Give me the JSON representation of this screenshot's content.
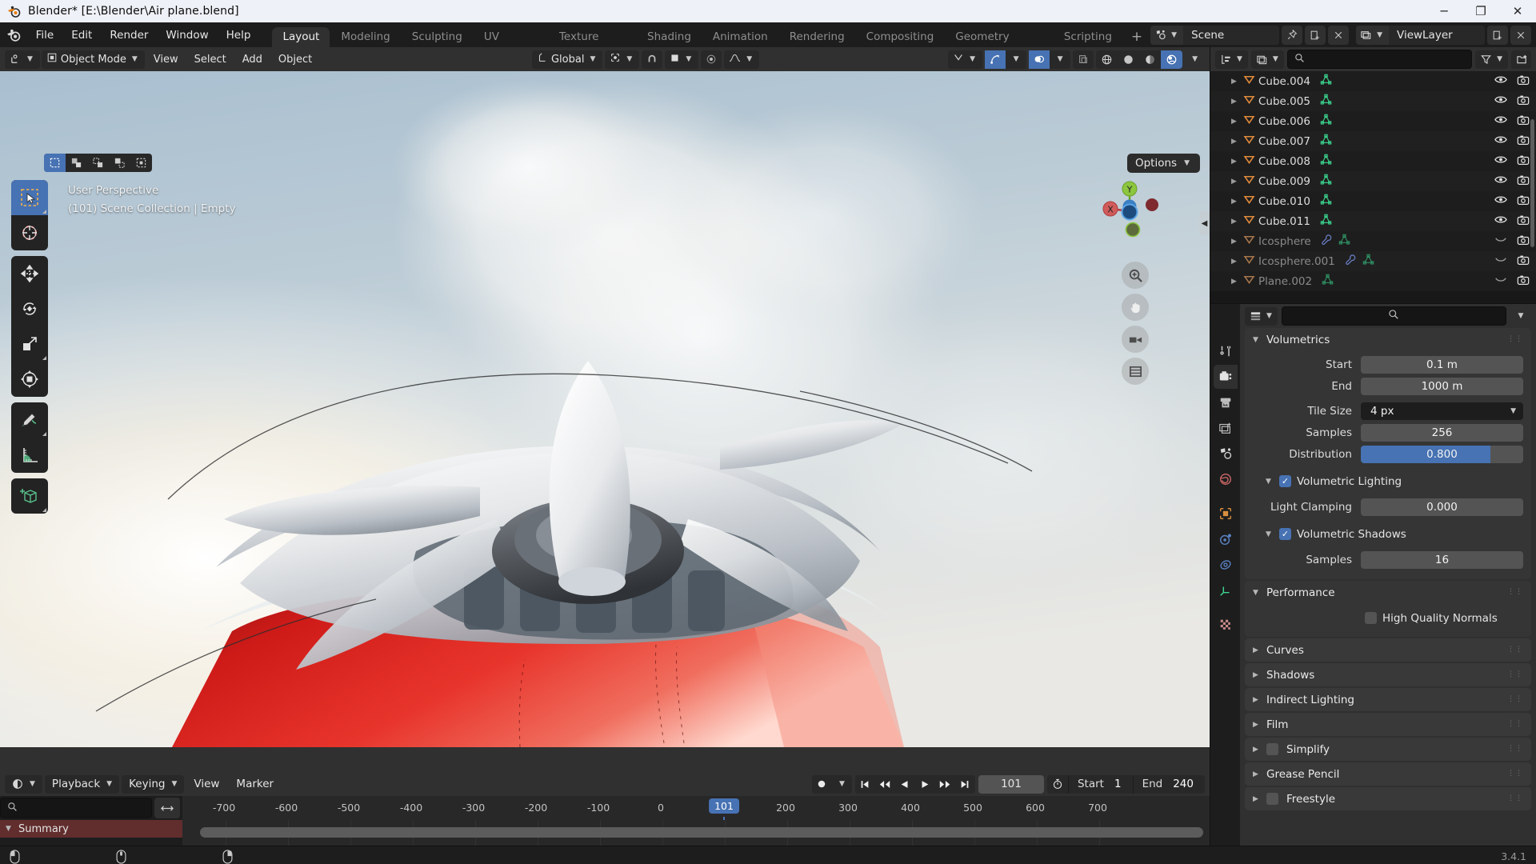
{
  "window": {
    "title": "Blender* [E:\\Blender\\Air plane.blend]",
    "minimize": "─",
    "maximize": "❐",
    "close": "✕"
  },
  "topbar": {
    "menus": [
      "File",
      "Edit",
      "Render",
      "Window",
      "Help"
    ],
    "workspaces": [
      "Layout",
      "Modeling",
      "Sculpting",
      "UV Editing",
      "Texture Paint",
      "Shading",
      "Animation",
      "Rendering",
      "Compositing",
      "Geometry Nodes",
      "Scripting"
    ],
    "active_workspace": "Layout",
    "add_workspace": "+",
    "scene_name": "Scene",
    "view_layer_name": "ViewLayer",
    "scene_icon": "scene-data-icon",
    "viewlayer_icon": "view-layer-icon",
    "pin_icon": "pin-icon",
    "new_scene_icon": "new-scene-icon",
    "remove_scene_icon": "remove-scene-icon",
    "copy_viewlayer_icon": "copy-viewlayer-icon",
    "remove_viewlayer_icon": "remove-viewlayer-icon"
  },
  "viewport": {
    "header": {
      "editor_type": "editor-type-3dview-icon",
      "mode": "Object Mode",
      "mode_icon": "object-mode-icon",
      "menus": [
        "View",
        "Select",
        "Add",
        "Object"
      ],
      "transform_orientation": "Global",
      "orientation_icon": "orientation-axes-icon",
      "pivot_icon": "pivot-point-icon",
      "snap_magnet_icon": "snap-magnet-icon",
      "snap_target_icon": "snap-target-icon",
      "proportional_icon": "proportional-edit-icon",
      "falloff_icon": "falloff-curve-icon",
      "visibility_icon": "object-visibility-icon",
      "gizmo_icon": "gizmo-icon",
      "overlays_icon": "overlays-icon",
      "xray_icon": "xray-toggle-icon",
      "shading_modes": [
        "wireframe",
        "solid",
        "material-preview",
        "rendered"
      ],
      "active_shading": "rendered"
    },
    "select_modes": [
      "tweak",
      "box-select",
      "circle-select",
      "lasso-select",
      "select-box-alt"
    ],
    "active_select_mode": "tweak",
    "options_label": "Options",
    "overlay_line1": "User Perspective",
    "overlay_line2": "(101) Scene Collection | Empty",
    "tools": [
      "select-box-tool",
      "cursor-tool",
      "move-tool",
      "rotate-tool",
      "scale-tool",
      "transform-tool",
      "annotate-tool",
      "measure-tool",
      "add-cube-tool"
    ],
    "active_tool": "select-box-tool",
    "gizmo_axes": {
      "x": "X",
      "y": "Y",
      "z": "Z"
    },
    "nav_buttons": [
      "zoom-nav-icon",
      "pan-hand-icon",
      "camera-view-icon",
      "toggle-ortho-icon"
    ]
  },
  "timeline": {
    "editor_icon": "editor-type-timeline-icon",
    "menus": [
      "Playback",
      "Keying",
      "View",
      "Marker"
    ],
    "record_icon": "auto-keying-icon",
    "transport": [
      "jump-to-start-icon",
      "jump-to-prev-keyframe-icon",
      "play-reverse-icon",
      "play-icon",
      "jump-to-next-keyframe-icon",
      "jump-to-end-icon"
    ],
    "current_frame": "101",
    "frame_icon": "stopwatch-icon",
    "start_label": "Start",
    "start_value": "1",
    "end_label": "End",
    "end_value": "240",
    "search_placeholder": "",
    "search_icon": "search-icon",
    "filter_arrows_icon": "expand-arrows-icon",
    "ruler_ticks": [
      "-700",
      "-600",
      "-500",
      "-400",
      "-300",
      "-200",
      "-100",
      "0",
      "200",
      "300",
      "400",
      "500",
      "600",
      "700"
    ],
    "playhead_label": "101",
    "channel_summary": "Summary"
  },
  "outliner": {
    "display_mode_icon": "outliner-display-mode-icon",
    "filter_id_icon": "filter-id-type-icon",
    "search_placeholder": "",
    "search_icon": "search-icon",
    "filter_icon": "filter-funnel-icon",
    "new_collection_icon": "new-collection-icon",
    "rows": [
      {
        "name": "Cube.004",
        "dim": false,
        "icons": [
          "mesh-data-icon"
        ]
      },
      {
        "name": "Cube.005",
        "dim": false,
        "icons": [
          "mesh-data-icon"
        ]
      },
      {
        "name": "Cube.006",
        "dim": false,
        "icons": [
          "mesh-data-icon"
        ]
      },
      {
        "name": "Cube.007",
        "dim": false,
        "icons": [
          "mesh-data-icon"
        ]
      },
      {
        "name": "Cube.008",
        "dim": false,
        "icons": [
          "mesh-data-icon"
        ]
      },
      {
        "name": "Cube.009",
        "dim": false,
        "icons": [
          "mesh-data-icon"
        ]
      },
      {
        "name": "Cube.010",
        "dim": false,
        "icons": [
          "mesh-data-icon"
        ]
      },
      {
        "name": "Cube.011",
        "dim": false,
        "icons": [
          "mesh-data-icon"
        ]
      },
      {
        "name": "Icosphere",
        "dim": true,
        "icons": [
          "modifier-wrench-icon",
          "mesh-data-icon"
        ]
      },
      {
        "name": "Icosphere.001",
        "dim": true,
        "icons": [
          "modifier-wrench-icon",
          "mesh-data-icon"
        ]
      },
      {
        "name": "Plane.002",
        "dim": true,
        "icons": [
          "mesh-data-icon"
        ]
      }
    ],
    "visibility_icon": "eye-icon",
    "render_icon": "camera-icon"
  },
  "properties": {
    "editor_icon": "editor-type-properties-icon",
    "search_placeholder": "",
    "search_icon": "search-icon",
    "dropdown_icon": "chevron-down-icon",
    "tabs": [
      "tool-icon",
      "render-icon",
      "output-icon",
      "view-layer-icon",
      "scene-icon",
      "world-icon",
      "object-icon",
      "modifier-physics-icon",
      "constraints-icon",
      "object-data-icon",
      "material-icon"
    ],
    "active_tab": "render-icon",
    "panels": [
      {
        "title": "Volumetrics",
        "open": true,
        "rows": [
          {
            "label": "Start",
            "value": "0.1 m",
            "kind": "field"
          },
          {
            "label": "End",
            "value": "1000 m",
            "kind": "field"
          },
          {
            "label": "Tile Size",
            "value": "4 px",
            "kind": "dropdown"
          },
          {
            "label": "Samples",
            "value": "256",
            "kind": "field"
          },
          {
            "label": "Distribution",
            "value": "0.800",
            "kind": "slider",
            "fill": 0.8
          }
        ],
        "checks": [
          {
            "label": "Volumetric Lighting",
            "checked": true,
            "expandable": true
          },
          {
            "label": "Light Clamping",
            "value": "0.000",
            "kind": "field"
          },
          {
            "label": "Volumetric Shadows",
            "checked": true,
            "expandable": true
          },
          {
            "label": "Samples",
            "value": "16",
            "kind": "field"
          }
        ]
      },
      {
        "title": "Performance",
        "open": true,
        "checkbox_rows": [
          {
            "label": "High Quality Normals",
            "checked": false
          }
        ]
      },
      {
        "title": "Curves",
        "open": false
      },
      {
        "title": "Shadows",
        "open": false
      },
      {
        "title": "Indirect Lighting",
        "open": false
      },
      {
        "title": "Film",
        "open": false
      },
      {
        "title": "Simplify",
        "open": false,
        "has_checkbox": true,
        "checked": false
      },
      {
        "title": "Grease Pencil",
        "open": false
      },
      {
        "title": "Freestyle",
        "open": false,
        "has_checkbox": true,
        "checked": false
      }
    ]
  },
  "statusbar": {
    "mouse_hints": [
      "mouse-left-icon",
      "mouse-middle-icon",
      "mouse-right-icon"
    ],
    "version": "3.4.1"
  },
  "colors": {
    "accent_blue": "#4772b3",
    "mesh_green": "#3bd68f",
    "object_orange": "#e08a3c",
    "summary_red": "#612d2d",
    "header_gray": "#303030",
    "editor_bg": "#181818"
  }
}
